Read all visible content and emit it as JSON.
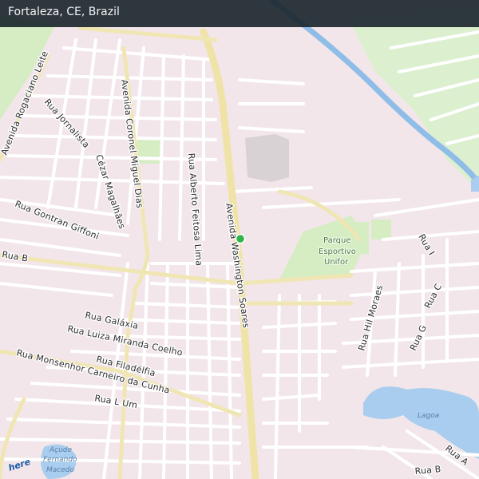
{
  "header": {
    "title": "Fortaleza, CE, Brazil"
  },
  "map": {
    "logo": "here",
    "marker": {
      "color": "#2fb34a",
      "type": "location-dot"
    },
    "colors": {
      "background": "#f2e6ea",
      "major_road": "#f0e6b4",
      "minor_road": "#ffffff",
      "park": "#d6edc3",
      "water": "#a9cdee",
      "building": "#d8d2d4",
      "river": "#8fbde8"
    },
    "streets": [
      {
        "id": "av-rogaciano-leite",
        "text": "Avenida Rogaciano Leite"
      },
      {
        "id": "rua-jornalista",
        "text": "Rua Jornalista"
      },
      {
        "id": "cezar-magalhaes",
        "text": "Cézar Magalhães"
      },
      {
        "id": "av-coronel-miguel-dias",
        "text": "Avenida Coronel Miguel Dias"
      },
      {
        "id": "rua-alberto-feitosa-lima",
        "text": "Rua Alberto Feitosa Lima"
      },
      {
        "id": "av-washington-soares",
        "text": "Avenida Washington Soares"
      },
      {
        "id": "rua-gontran-giffoni",
        "text": "Rua Gontran Giffoni"
      },
      {
        "id": "rua-b-west",
        "text": "Rua B"
      },
      {
        "id": "rua-galaxia",
        "text": "Rua Galáxia"
      },
      {
        "id": "rua-luiza-miranda-coelho",
        "text": "Rua Luiza Miranda Coelho"
      },
      {
        "id": "rua-filadelfia",
        "text": "Rua Filadélfia"
      },
      {
        "id": "rua-monsenhor",
        "text": "Rua Monsenhor Carneiro da Cunha"
      },
      {
        "id": "rua-l-um",
        "text": "Rua L Um"
      },
      {
        "id": "rua-hil-moraes",
        "text": "Rua Hil Moraes"
      },
      {
        "id": "rua-g",
        "text": "Rua G"
      },
      {
        "id": "rua-c",
        "text": "Rua C"
      },
      {
        "id": "rua-i",
        "text": "Rua I"
      },
      {
        "id": "rua-a",
        "text": "Rua A"
      },
      {
        "id": "rua-b-east",
        "text": "Rua B"
      }
    ],
    "pois": [
      {
        "id": "parque-esportivo",
        "lines": [
          "Parque",
          "Esportivo",
          "Unifor"
        ]
      }
    ],
    "water_labels": [
      {
        "id": "lagoa",
        "lines": [
          "Lagoa"
        ]
      },
      {
        "id": "acude",
        "lines": [
          "Açude",
          "Fernando",
          "Macedo"
        ]
      }
    ]
  }
}
